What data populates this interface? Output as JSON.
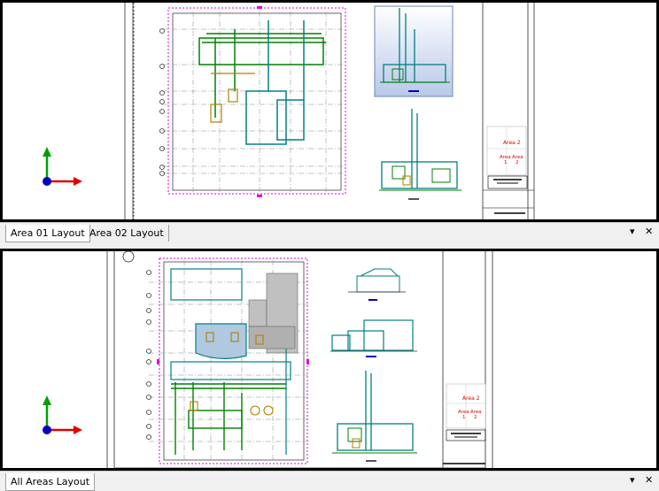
{
  "viewport_top": {
    "area_labels": {
      "area2": "Area 2",
      "area": "Area",
      "area_right": "Area",
      "num1": "1",
      "num2": "2"
    }
  },
  "tabs_top": [
    {
      "label": "Area 01 Layout",
      "active": true
    },
    {
      "label": "Area 02 Layout",
      "active": false
    }
  ],
  "viewport_bottom": {
    "area_labels": {
      "area2": "Area 2",
      "area": "Area",
      "area_right": "Area",
      "num1": "1",
      "num2": "2"
    }
  },
  "tabs_bottom": [
    {
      "label": "All Areas Layout",
      "active": true
    }
  ],
  "controls": {
    "dropdown_icon": "▾",
    "close_icon": "✕"
  },
  "colors": {
    "axis_x": "#e00000",
    "axis_y": "#00a000",
    "axis_origin": "#0000c0",
    "cad_cyan": "#008080",
    "cad_green": "#008000",
    "cad_magenta": "#e000e0",
    "cad_yellow": "#b08000"
  }
}
